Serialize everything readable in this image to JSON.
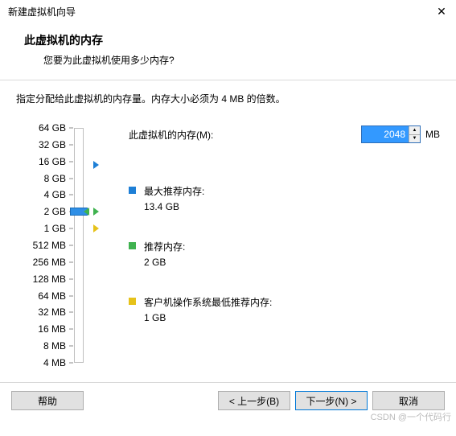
{
  "window": {
    "title": "新建虚拟机向导",
    "close": "✕"
  },
  "header": {
    "title": "此虚拟机的内存",
    "subtitle": "您要为此虚拟机使用多少内存?"
  },
  "instruction": "指定分配给此虚拟机的内存量。内存大小必须为 4 MB 的倍数。",
  "memory": {
    "label": "此虚拟机的内存(M):",
    "value": "2048",
    "unit": "MB"
  },
  "slider": {
    "labels": [
      "64 GB",
      "32 GB",
      "16 GB",
      "8 GB",
      "4 GB",
      "2 GB",
      "1 GB",
      "512 MB",
      "256 MB",
      "128 MB",
      "64 MB",
      "32 MB",
      "16 MB",
      "8 MB",
      "4 MB"
    ]
  },
  "recommendations": {
    "max": {
      "title": "最大推荐内存:",
      "value": "13.4 GB",
      "color": "#1e7fd6"
    },
    "rec": {
      "title": "推荐内存:",
      "value": "2 GB",
      "color": "#3fb24f"
    },
    "min": {
      "title": "客户机操作系统最低推荐内存:",
      "value": "1 GB",
      "color": "#e6c21a"
    }
  },
  "buttons": {
    "help": "帮助",
    "back": "< 上一步(B)",
    "next": "下一步(N) >",
    "cancel": "取消"
  },
  "watermark": "CSDN @一个代码行"
}
